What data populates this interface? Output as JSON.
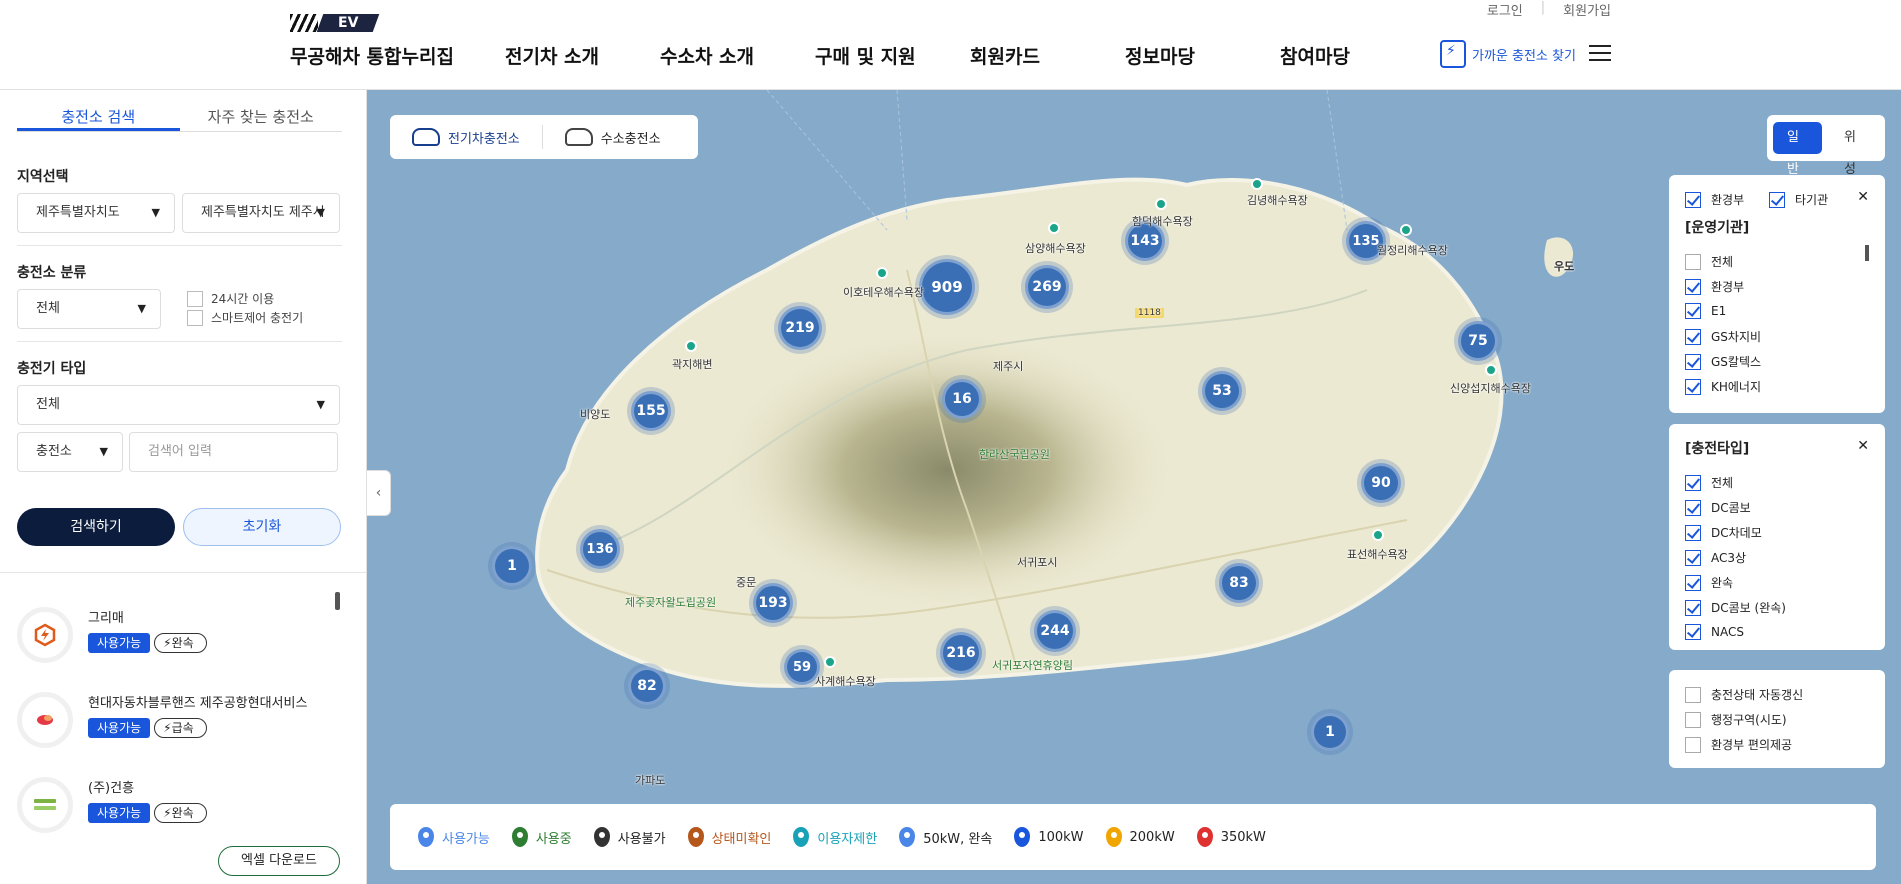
{
  "header": {
    "util": [
      "로그인",
      "회원가입"
    ],
    "logo_text": "EV",
    "site_title": "무공해차 통합누리집",
    "nav": [
      "전기차 소개",
      "수소차 소개",
      "구매 및 지원",
      "회원카드",
      "정보마당",
      "참여마당"
    ],
    "find_charger": "가까운 충전소 찾기"
  },
  "left": {
    "tabs": [
      "충전소 검색",
      "자주 찾는 충전소"
    ],
    "region_label": "지역선택",
    "region_1": "제주특별자치도",
    "region_2": "제주특별자치도 제주시",
    "class_label": "충전소 분류",
    "class_value": "전체",
    "opt_24h": "24시간 이용",
    "opt_smart": "스마트제어 충전기",
    "type_label": "충전기 타입",
    "type_value": "전체",
    "search_target": "충전소",
    "search_placeholder": "검색어 입력",
    "search_btn": "검색하기",
    "reset_btn": "초기화",
    "stations": [
      {
        "name": "그리매",
        "status": "사용가능",
        "speed": "완속"
      },
      {
        "name": "현대자동차블루핸즈 제주공항현대서비스",
        "status": "사용가능",
        "speed": "급속"
      },
      {
        "name": "(주)건흥",
        "status": "사용가능",
        "speed": "완속"
      }
    ],
    "excel_btn": "엑셀 다운로드"
  },
  "map": {
    "tabs": [
      "전기차충전소",
      "수소충전소"
    ],
    "view": [
      "일반",
      "위성"
    ],
    "clusters": [
      {
        "v": "909"
      },
      {
        "v": "269"
      },
      {
        "v": "143"
      },
      {
        "v": "135"
      },
      {
        "v": "219"
      },
      {
        "v": "16"
      },
      {
        "v": "53"
      },
      {
        "v": "75"
      },
      {
        "v": "155"
      },
      {
        "v": "90"
      },
      {
        "v": "136"
      },
      {
        "v": "1"
      },
      {
        "v": "193"
      },
      {
        "v": "83"
      },
      {
        "v": "244"
      },
      {
        "v": "216"
      },
      {
        "v": "59"
      },
      {
        "v": "82"
      },
      {
        "v": "1"
      }
    ],
    "places": [
      "김녕해수욕장",
      "함덕해수욕장",
      "삼양해수욕장",
      "이호테우해수욕장",
      "월정리해수욕장",
      "우도",
      "곽지해변",
      "제주시",
      "비양도",
      "신양섭지해수욕장",
      "한라산국립공원",
      "서귀포시",
      "표선해수욕장",
      "제주곶자왈도립공원",
      "중문",
      "사계해수욕장",
      "서귀포자연휴양림",
      "가파도",
      "1118"
    ],
    "operator": {
      "top": [
        "환경부",
        "타기관"
      ],
      "title": "[운영기관]",
      "items": [
        "전체",
        "환경부",
        "E1",
        "GS차지비",
        "GS칼텍스",
        "KH에너지"
      ]
    },
    "charge_type": {
      "title": "[충전타입]",
      "items": [
        "전체",
        "DC콤보",
        "DC차데모",
        "AC3상",
        "완속",
        "DC콤보 (완속)",
        "NACS"
      ]
    },
    "extra": [
      "충전상태 자동갱신",
      "행정구역(시도)",
      "환경부 편의제공"
    ],
    "legend": [
      "사용가능",
      "사용중",
      "사용불가",
      "상태미확인",
      "이용자제한",
      "50kW, 완속",
      "100kW",
      "200kW",
      "350kW"
    ],
    "legend_colors": [
      "#4a86e8",
      "#2e7d32",
      "#333333",
      "#b5561b",
      "#17a2b8",
      "#4a86e8",
      "#1a56db",
      "#f0a500",
      "#e03131"
    ]
  }
}
